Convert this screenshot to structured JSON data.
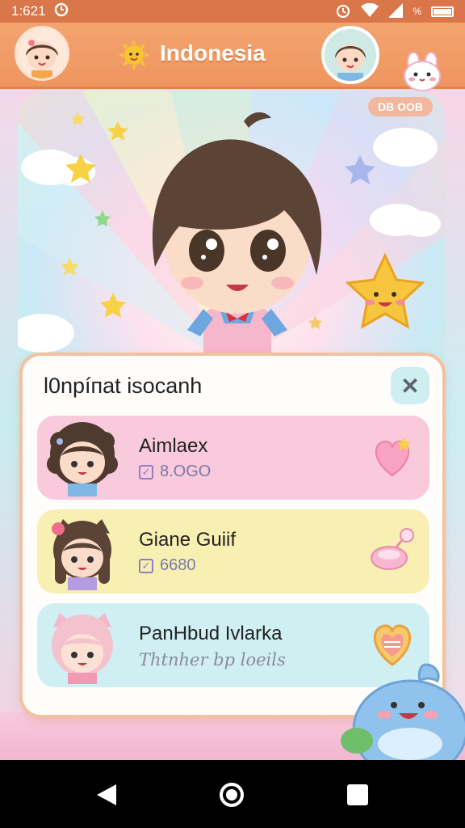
{
  "status_bar": {
    "time": "1:621",
    "right_text": "%"
  },
  "header": {
    "title": "Indonesia"
  },
  "stage": {
    "badge": "DB OOB"
  },
  "panel": {
    "title": "Ɩ0npíпat isocanh",
    "close_label": "✕",
    "cards": [
      {
        "name": "Aimlaex",
        "sub": "8.OGO",
        "color": "#f9c9dc",
        "action_icon": "heart-icon"
      },
      {
        "name": "Giane Guiif",
        "sub": "6680",
        "color": "#f8f0b2",
        "action_icon": "ring-icon"
      },
      {
        "name": "PanHbud Ivlarka",
        "sub": "Thtnher bp loeils",
        "color": "#cfeff3",
        "action_icon": "heart-badge-icon"
      }
    ]
  },
  "colors": {
    "status_bar": "#d9774a",
    "header": "#ef9560",
    "panel_border": "#f2c19e",
    "nav_bar": "#000000"
  }
}
